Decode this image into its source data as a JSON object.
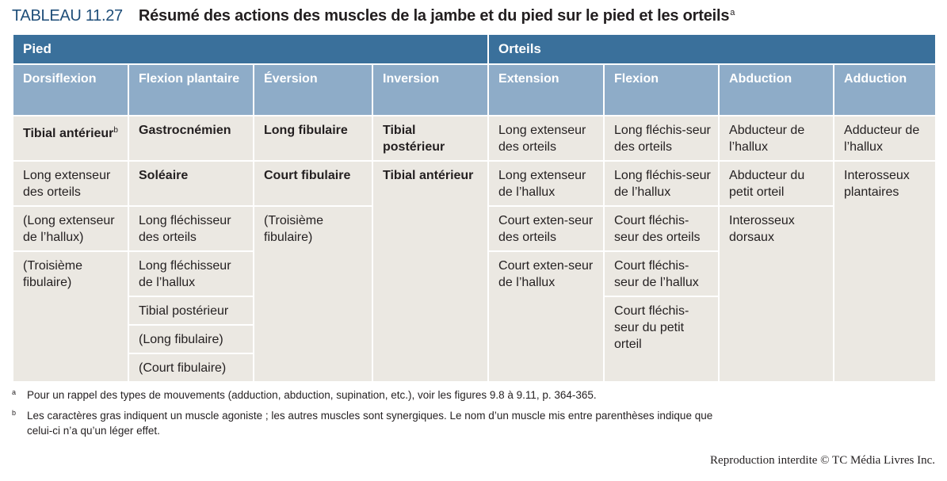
{
  "title": {
    "label": "TABLEAU 11.27",
    "text": "Résumé des actions des muscles de la jambe et du pied sur le pied et les orteils",
    "footnote_mark": "a"
  },
  "groups": {
    "pied": "Pied",
    "orteils": "Orteils"
  },
  "headers": {
    "dorsiflexion": "Dorsiflexion",
    "flexion_plantaire": "Flexion plantaire",
    "eversion": "Éversion",
    "inversion": "Inversion",
    "extension": "Extension",
    "flexion": "Flexion",
    "abduction": "Abduction",
    "adduction": "Adduction"
  },
  "cells": {
    "dorsiflexion": [
      "Tibial antérieur",
      "Long extenseur des orteils",
      "(Long extenseur de l’hallux)",
      "(Troisième fibulaire)"
    ],
    "dorsiflexion_mark": "b",
    "flexion_plantaire": [
      "Gastrocnémien",
      "Soléaire",
      "Long fléchisseur des orteils",
      "Long fléchisseur de l’hallux",
      "Tibial postérieur",
      "(Long fibulaire)",
      "(Court fibulaire)"
    ],
    "eversion": [
      "Long fibulaire",
      "Court fibulaire",
      "(Troisième fibulaire)"
    ],
    "inversion": [
      "Tibial postérieur",
      "Tibial antérieur"
    ],
    "extension": [
      "Long extenseur des orteils",
      "Long extenseur de l’hallux",
      "Court exten-seur des orteils",
      "Court exten-seur de l’hallux"
    ],
    "flexion": [
      "Long fléchis-seur des orteils",
      "Long fléchis-seur de l’hallux",
      "Court fléchis-seur des orteils",
      "Court fléchis-seur de l’hallux",
      "Court fléchis-seur du petit orteil"
    ],
    "abduction": [
      "Abducteur de l’hallux",
      "Abducteur du petit orteil",
      "Interosseux dorsaux"
    ],
    "adduction": [
      "Adducteur de l’hallux",
      "Interosseux plantaires"
    ]
  },
  "footnotes": [
    {
      "mark": "a",
      "text": "Pour un rappel des types de mouvements (adduction, abduction, supination, etc.), voir les figures 9.8 à 9.11, p. 364-365."
    },
    {
      "mark": "b",
      "text": "Les caractères gras indiquent un muscle agoniste ; les autres muscles sont synergiques. Le nom d’un muscle mis entre parenthèses indique que celui-ci n’a qu’un léger effet."
    }
  ],
  "credit": "Reproduction interdite © TC Média Livres Inc.",
  "colors": {
    "group_header": "#3a709b",
    "sub_header": "#8eacc8",
    "cell": "#ebe8e2",
    "title_label": "#1f4e79"
  }
}
